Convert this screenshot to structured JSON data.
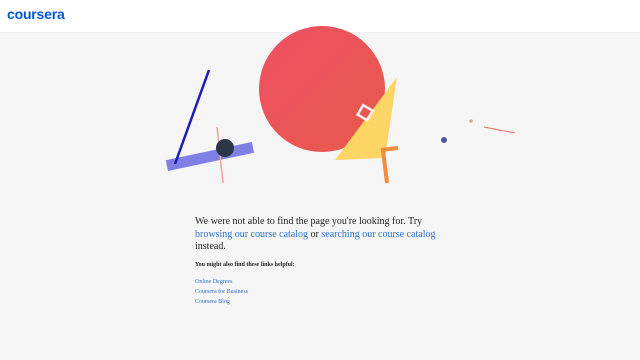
{
  "header": {
    "logo_text": "coursera"
  },
  "error": {
    "line1": "We were not able to find the page you're looking for. Try",
    "link1": "browsing our course catalog",
    "connector": " or ",
    "link2": "searching our course catalog",
    "tail": "instead."
  },
  "helpful": {
    "heading": "You might also find these links helpful:",
    "links": [
      "Online Degrees",
      "Coursera for Business",
      "Coursera Blog"
    ]
  },
  "colors": {
    "brand": "#0056d2",
    "link": "#2a73cc",
    "circle": "#e8505b",
    "triangle": "#fdd565",
    "bar": "#7f7fe6",
    "line": "#1d1db5",
    "orange": "#f28b3b"
  }
}
